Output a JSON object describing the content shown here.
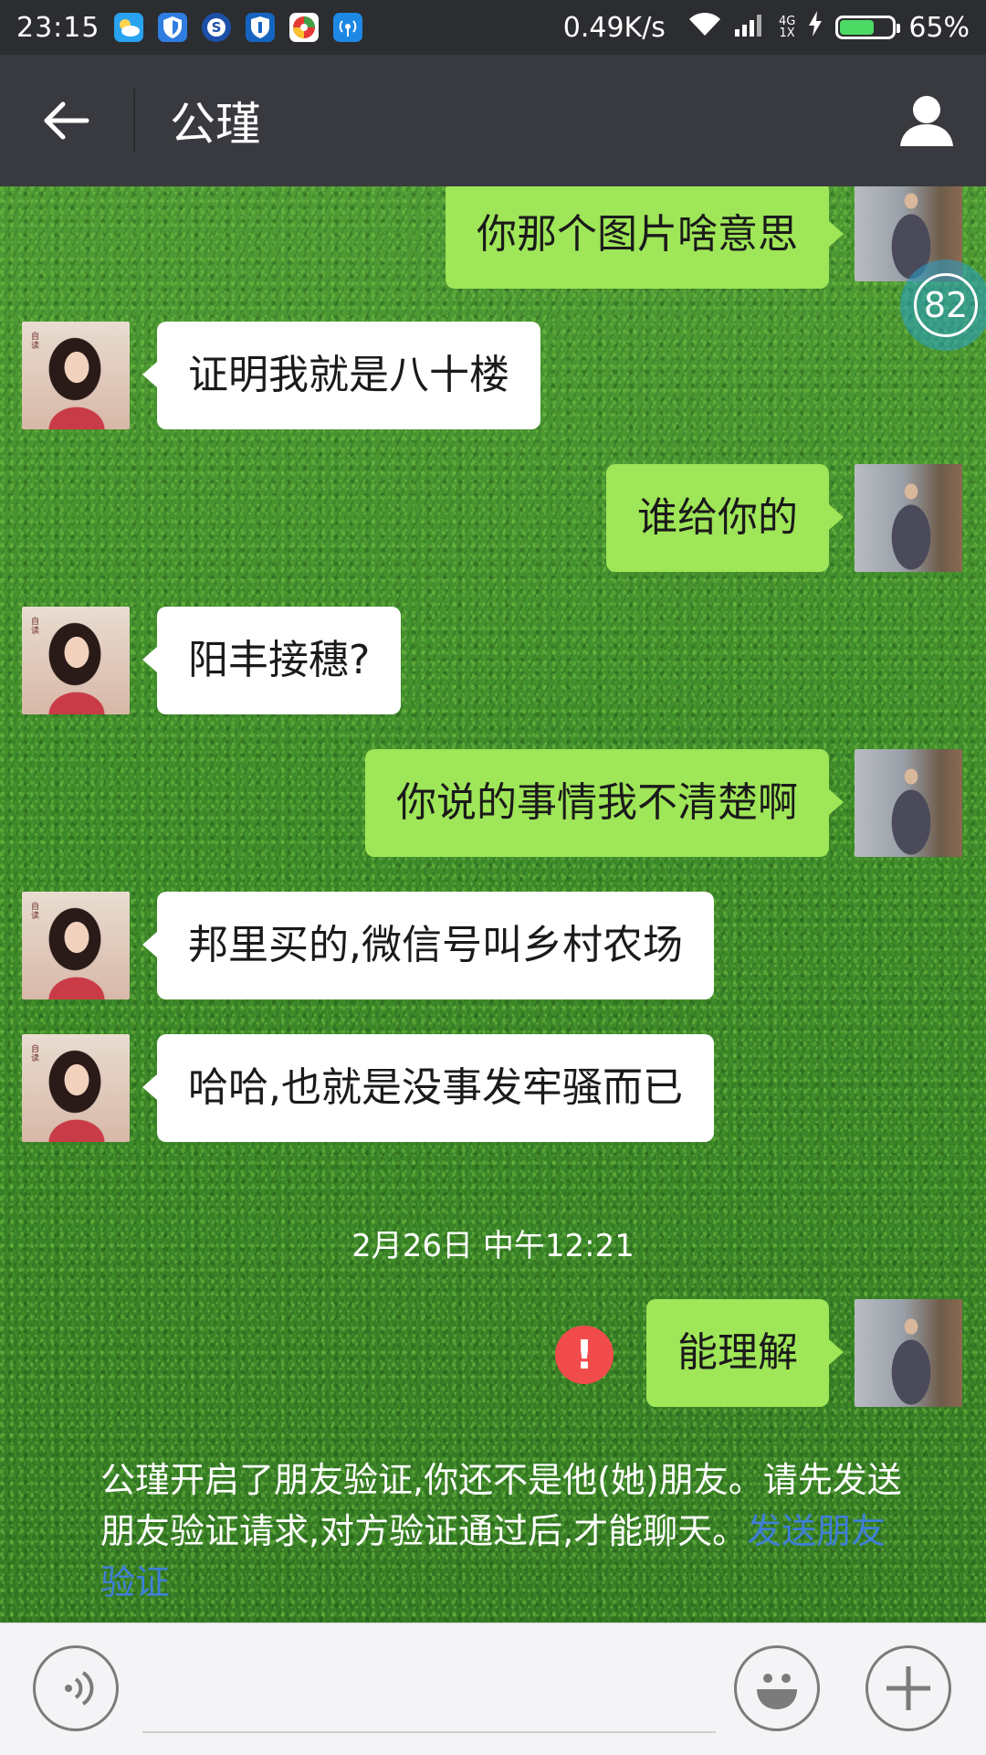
{
  "status_bar": {
    "time": "23:15",
    "notification_icons": [
      "weather-icon",
      "shield-icon",
      "sogou-icon",
      "security-icon",
      "app-icon",
      "hotspot-icon"
    ],
    "net_speed": "0.49K/s",
    "network_top": "4G",
    "network_bottom": "1X",
    "battery_percent": 65,
    "battery_label": "65%"
  },
  "header": {
    "title": "公瑾"
  },
  "messages": [
    {
      "side": "out",
      "text": "你那个图片啥意思"
    },
    {
      "side": "in",
      "text": "证明我就是八十楼"
    },
    {
      "side": "out",
      "text": "谁给你的"
    },
    {
      "side": "in",
      "text": "阳丰接穗?"
    },
    {
      "side": "out",
      "text": "你说的事情我不清楚啊"
    },
    {
      "side": "in",
      "text": "邦里买的,微信号叫乡村农场"
    },
    {
      "side": "in",
      "text": "哈哈,也就是没事发牢骚而已"
    },
    {
      "side": "out",
      "text": "能理解",
      "status": "failed"
    }
  ],
  "unread_badge": "82",
  "timestamp": "2月26日 中午12:21",
  "avatar_seal_text": "自读",
  "system_message": {
    "text": "公瑾开启了朋友验证,你还不是他(她)朋友。请先发送朋友验证请求,对方验证通过后,才能聊天。",
    "link": "发送朋友验证"
  },
  "input_bar": {
    "value": "",
    "placeholder": ""
  },
  "colors": {
    "status_bar": "#2b2d30",
    "title_bar": "#393a3f",
    "outgoing_bubble": "#9fe658",
    "incoming_bubble": "#ffffff",
    "failed_icon": "#f24b4b",
    "link": "#3f7fd6"
  }
}
